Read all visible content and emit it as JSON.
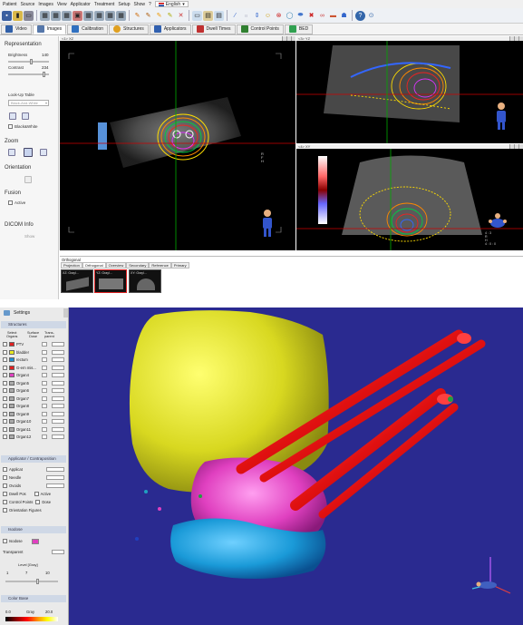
{
  "menu": {
    "items": [
      "Patient",
      "Source",
      "Images",
      "View",
      "Applicator",
      "Treatment",
      "Setup",
      "Show",
      "?"
    ],
    "language": "English"
  },
  "tabs": [
    {
      "label": "Video",
      "color": "#2f5fa8"
    },
    {
      "label": "Images",
      "color": "#5577aa"
    },
    {
      "label": "Calibration",
      "color": "#3070c0"
    },
    {
      "label": "Structures",
      "color": "#e0a020"
    },
    {
      "label": "Applicators",
      "color": "#3060b0"
    },
    {
      "label": "Dwell Times",
      "color": "#c03030"
    },
    {
      "label": "Control Points",
      "color": "#308030"
    },
    {
      "label": "BED",
      "color": "#30a050"
    }
  ],
  "left": {
    "representation": "Representation",
    "brightness_label": "Brightness",
    "brightness_value": "140",
    "contrast_label": "Contrast",
    "contrast_value": "234",
    "lut_label": "Look-Up Table",
    "lut_value": "Black-And-White",
    "black_white": "Black&White",
    "zoom": "Zoom",
    "orientation": "Orientation",
    "fusion": "Fusion",
    "active": "Active",
    "dicom": "DICOM Info",
    "show": "Show"
  },
  "views": {
    "main": "<1> XZ",
    "top_right": "<3> YZ",
    "bottom_right": "<4> XY"
  },
  "overlay": {
    "main_letters": "R\nF\nH",
    "br_info": "4 : 3\nR\nH\n4 : 0 : 0"
  },
  "strip": {
    "title": "Orthogonal",
    "tabs": [
      "Projection",
      "Orthogonal",
      "Overview",
      "Secondary",
      "Reference",
      "Primary"
    ],
    "thumbs": [
      "XZ: Grayl...",
      "YZ: Grayl...",
      "XY: Grayl..."
    ]
  },
  "settings": {
    "title": "Settings",
    "structures_header": "Structures",
    "col_select": "Select\nOrgans",
    "col_surface": "Surface\nDose",
    "col_transp": "Trans-\nparent",
    "organs": [
      {
        "name": "PTV",
        "color": "#e02020"
      },
      {
        "name": "bladder",
        "color": "#e8e820"
      },
      {
        "name": "rectum",
        "color": "#2090d0"
      },
      {
        "name": "G-ern mis...",
        "color": "#e02020"
      },
      {
        "name": "Organ4",
        "color": "#e040c0"
      },
      {
        "name": "Organ5",
        "color": "#aaaaaa"
      },
      {
        "name": "Organ6",
        "color": "#aaaaaa"
      },
      {
        "name": "Organ7",
        "color": "#aaaaaa"
      },
      {
        "name": "Organ8",
        "color": "#aaaaaa"
      },
      {
        "name": "Organ9",
        "color": "#aaaaaa"
      },
      {
        "name": "Organ10",
        "color": "#aaaaaa"
      },
      {
        "name": "Organ11",
        "color": "#aaaaaa"
      },
      {
        "name": "Organ12",
        "color": "#aaaaaa"
      }
    ],
    "appl_header": "Applicator / Contraposition",
    "applicat": "Applicat",
    "needle": "Needle",
    "ovoids": "Ovoids",
    "dwell_pos": "Dwell Pos",
    "active": "Active",
    "control_points": "Control Points",
    "dose": "Dose",
    "orient_figures": "Orientation Figures",
    "isodose_header": "Isodose",
    "isodose": "Isodose",
    "transparent": "Transparent",
    "level_label": "Level [Gray]",
    "level_min": "1",
    "level_val": "7",
    "level_max": "10",
    "colorbase_header": "Color Base",
    "gray": "Gray",
    "cb_min": "0.0",
    "cb_max": "20.0"
  }
}
